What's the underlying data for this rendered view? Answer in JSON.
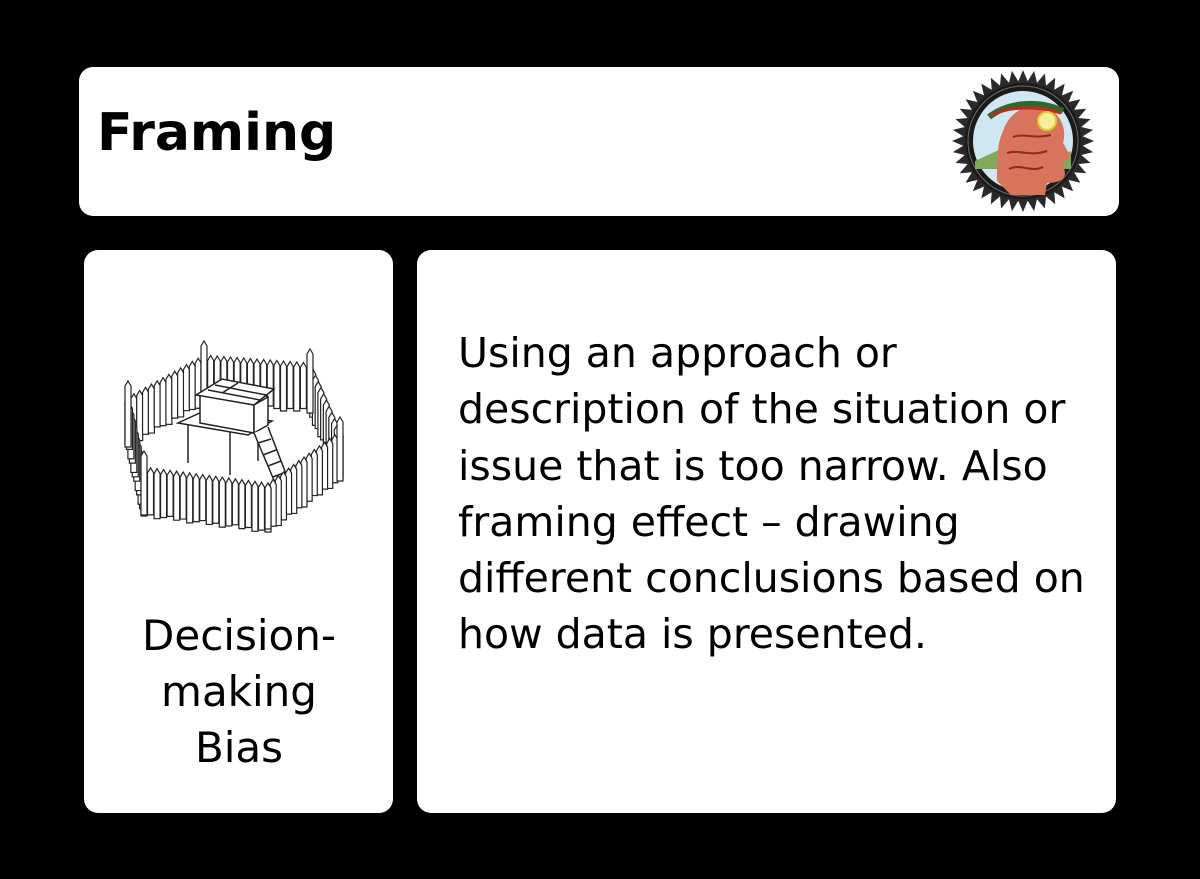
{
  "card": {
    "title": "Framing",
    "category": "Decision-making Bias",
    "description": "Using an approach or description of the situation or issue that is too narrow. Also framing effect – drawing different conclusions based on how data is presented.",
    "badge_icon": "laurel-head-seal-icon",
    "illustration_icon": "stockade-fort-icon"
  },
  "colors": {
    "background": "#000000",
    "panel": "#ffffff",
    "text": "#000000"
  }
}
